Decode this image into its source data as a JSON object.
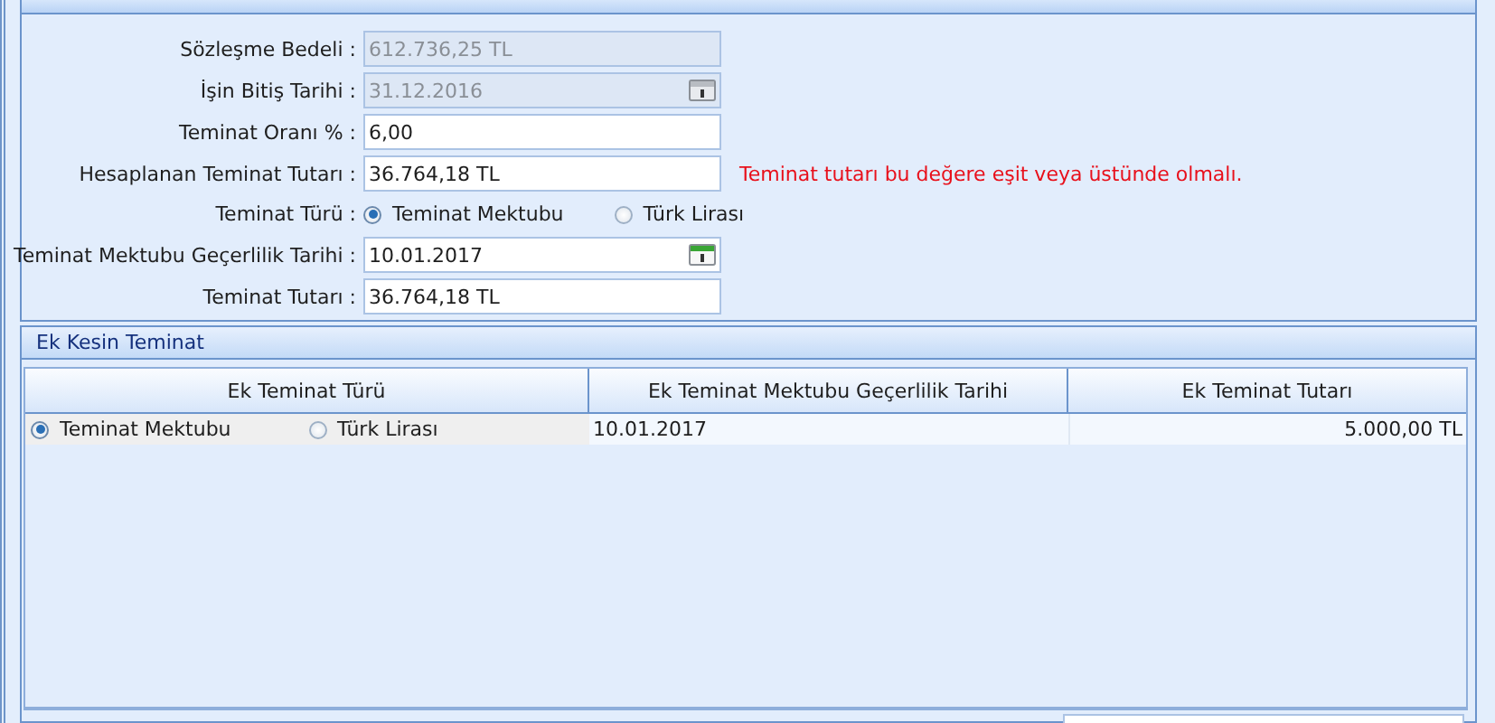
{
  "main_panel": {
    "fields": [
      {
        "label": "Sözleşme Bedeli :",
        "kind": "text",
        "value": "612.736,25 TL",
        "disabled": true
      },
      {
        "label": "İşin Bitiş Tarihi :",
        "kind": "date",
        "value": "31.12.2016",
        "disabled": true
      },
      {
        "label": "Teminat Oranı % :",
        "kind": "text",
        "value": "6,00",
        "disabled": false
      },
      {
        "label": "Hesaplanan Teminat Tutarı :",
        "kind": "text",
        "value": "36.764,18 TL",
        "disabled": false,
        "message": "Teminat tutarı bu değere eşit veya üstünde olmalı."
      },
      {
        "label": "Teminat Türü :",
        "kind": "radio",
        "options": [
          {
            "label": "Teminat Mektubu",
            "selected": true
          },
          {
            "label": "Türk Lirası",
            "selected": false
          }
        ]
      },
      {
        "label": "Teminat Mektubu Geçerlilik Tarihi :",
        "kind": "date",
        "value": "10.01.2017",
        "disabled": false
      },
      {
        "label": "Teminat Tutarı :",
        "kind": "text",
        "value": "36.764,18 TL",
        "disabled": false
      }
    ]
  },
  "extra_panel": {
    "title": "Ek Kesin Teminat",
    "table": {
      "columns": [
        "Ek Teminat Türü",
        "Ek Teminat Mektubu Geçerlilik Tarihi",
        "Ek Teminat Tutarı"
      ],
      "rows": [
        {
          "type_options": [
            {
              "label": "Teminat Mektubu",
              "selected": true
            },
            {
              "label": "Türk Lirası",
              "selected": false
            }
          ],
          "date": "10.01.2017",
          "amount": "5.000,00 TL"
        }
      ]
    }
  }
}
